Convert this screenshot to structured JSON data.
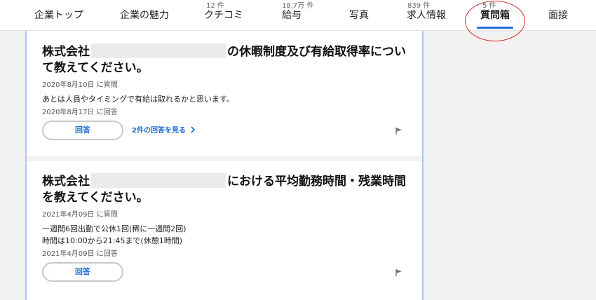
{
  "nav": {
    "tabs": [
      {
        "label": "企業トップ",
        "count": ""
      },
      {
        "label": "企業の魅力",
        "count": ""
      },
      {
        "label": "クチコミ",
        "count": "12 件"
      },
      {
        "label": "給与",
        "count": "18.7万 件"
      },
      {
        "label": "写真",
        "count": ""
      },
      {
        "label": "求人情報",
        "count": "839 件"
      },
      {
        "label": "質問箱",
        "count": "5 件"
      },
      {
        "label": "面接",
        "count": ""
      }
    ],
    "active_tab": "質問箱",
    "accent_color": "#1f6fd6",
    "annotation_color": "#d92b2b"
  },
  "questions": [
    {
      "title_prefix": "株式会社",
      "title_suffix": "の休暇制度及び有給取得率について教えてください。",
      "asked_date": "2020年8月10日 に質問",
      "body_lines": [
        "あとは人員やタイミングで有給は取れるかと思います。"
      ],
      "answered_date": "2020年8月17日 に回答",
      "answer_button": "回答",
      "answers_link": "2件の回答を見る"
    },
    {
      "title_prefix": "株式会社",
      "title_suffix": "における平均勤務時間・残業時間を教えてください。",
      "asked_date": "2021年4月09日 に質問",
      "body_lines": [
        "一週間6回出勤で公休1回(稀に一週間2回)",
        "時間は10:00から21:45まで(休憩1時間)"
      ],
      "answered_date": "2021年4月09日 に回答",
      "answer_button": "回答",
      "answers_link": ""
    }
  ]
}
